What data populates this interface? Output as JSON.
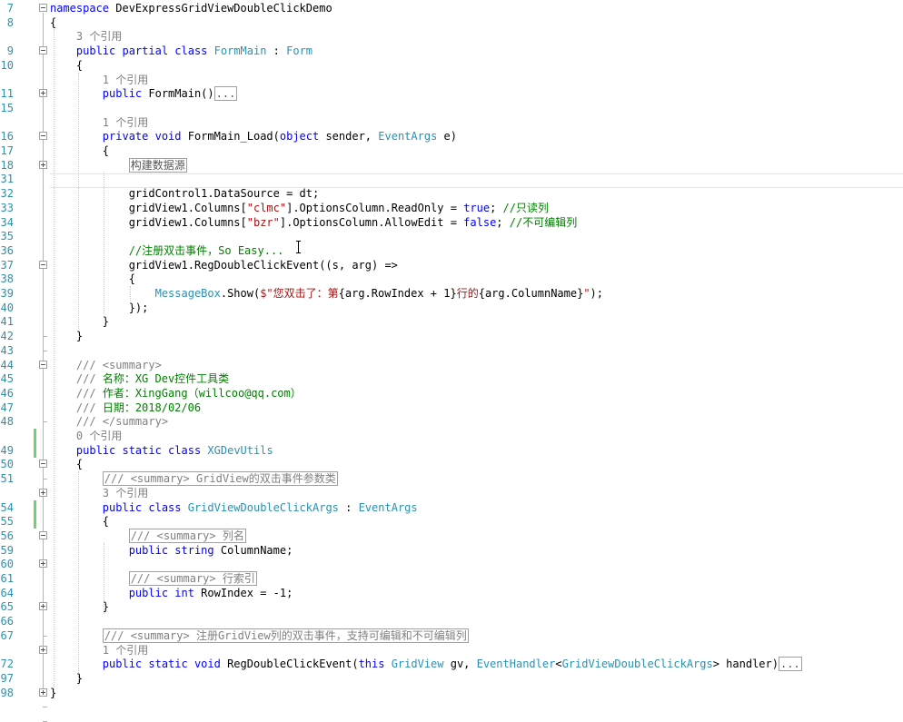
{
  "editor": {
    "lines": [
      {
        "num": "7",
        "tokens": [
          {
            "t": "kw",
            "v": "namespace"
          },
          {
            "t": "pl",
            "v": " DevExpressGridViewDoubleClickDemo"
          }
        ]
      },
      {
        "num": "8",
        "tokens": [
          {
            "t": "pl",
            "v": "{"
          }
        ]
      },
      {
        "num": "",
        "tokens": [
          {
            "t": "ref",
            "v": "    3 个引用"
          }
        ]
      },
      {
        "num": "9",
        "tokens": [
          {
            "t": "pl",
            "v": "    "
          },
          {
            "t": "kw",
            "v": "public partial class"
          },
          {
            "t": "pl",
            "v": " "
          },
          {
            "t": "ty",
            "v": "FormMain"
          },
          {
            "t": "pl",
            "v": " : "
          },
          {
            "t": "ty",
            "v": "Form"
          }
        ]
      },
      {
        "num": "10",
        "tokens": [
          {
            "t": "pl",
            "v": "    {"
          }
        ]
      },
      {
        "num": "",
        "tokens": [
          {
            "t": "ref",
            "v": "        1 个引用"
          }
        ]
      },
      {
        "num": "11",
        "tokens": [
          {
            "t": "pl",
            "v": "        "
          },
          {
            "t": "kw",
            "v": "public"
          },
          {
            "t": "pl",
            "v": " FormMain()"
          },
          {
            "t": "box",
            "v": "..."
          }
        ]
      },
      {
        "num": "15",
        "tokens": []
      },
      {
        "num": "",
        "tokens": [
          {
            "t": "ref",
            "v": "        1 个引用"
          }
        ]
      },
      {
        "num": "16",
        "tokens": [
          {
            "t": "pl",
            "v": "        "
          },
          {
            "t": "kw",
            "v": "private void"
          },
          {
            "t": "pl",
            "v": " FormMain_Load("
          },
          {
            "t": "kw",
            "v": "object"
          },
          {
            "t": "pl",
            "v": " sender, "
          },
          {
            "t": "ty",
            "v": "EventArgs"
          },
          {
            "t": "pl",
            "v": " e)"
          }
        ]
      },
      {
        "num": "17",
        "tokens": [
          {
            "t": "pl",
            "v": "        {"
          }
        ]
      },
      {
        "num": "18",
        "tokens": [
          {
            "t": "pl",
            "v": "            "
          },
          {
            "t": "box",
            "v": "构建数据源"
          }
        ]
      },
      {
        "num": "31",
        "tokens": []
      },
      {
        "num": "32",
        "tokens": [
          {
            "t": "pl",
            "v": "            gridControl1.DataSource = dt;"
          }
        ]
      },
      {
        "num": "33",
        "tokens": [
          {
            "t": "pl",
            "v": "            gridView1.Columns["
          },
          {
            "t": "st",
            "v": "\"clmc\""
          },
          {
            "t": "pl",
            "v": "].OptionsColumn.ReadOnly = "
          },
          {
            "t": "kw",
            "v": "true"
          },
          {
            "t": "pl",
            "v": "; "
          },
          {
            "t": "cm",
            "v": "//只读列"
          }
        ]
      },
      {
        "num": "34",
        "tokens": [
          {
            "t": "pl",
            "v": "            gridView1.Columns["
          },
          {
            "t": "st",
            "v": "\"bzr\""
          },
          {
            "t": "pl",
            "v": "].OptionsColumn.AllowEdit = "
          },
          {
            "t": "kw",
            "v": "false"
          },
          {
            "t": "pl",
            "v": "; "
          },
          {
            "t": "cm",
            "v": "//不可编辑列"
          }
        ]
      },
      {
        "num": "35",
        "tokens": []
      },
      {
        "num": "36",
        "tokens": [
          {
            "t": "pl",
            "v": "            "
          },
          {
            "t": "cm",
            "v": "//注册双击事件，So Easy..."
          }
        ]
      },
      {
        "num": "37",
        "tokens": [
          {
            "t": "pl",
            "v": "            gridView1.RegDoubleClickEvent((s, arg) =>"
          }
        ]
      },
      {
        "num": "38",
        "tokens": [
          {
            "t": "pl",
            "v": "            {"
          }
        ]
      },
      {
        "num": "39",
        "tokens": [
          {
            "t": "pl",
            "v": "                "
          },
          {
            "t": "ty",
            "v": "MessageBox"
          },
          {
            "t": "pl",
            "v": ".Show("
          },
          {
            "t": "st",
            "v": "$\"您双击了：第"
          },
          {
            "t": "pl",
            "v": "{arg.RowIndex + 1}"
          },
          {
            "t": "st",
            "v": "行的"
          },
          {
            "t": "pl",
            "v": "{arg.ColumnName}"
          },
          {
            "t": "st",
            "v": "\""
          },
          {
            "t": "pl",
            "v": ");"
          }
        ]
      },
      {
        "num": "40",
        "tokens": [
          {
            "t": "pl",
            "v": "            });"
          }
        ]
      },
      {
        "num": "41",
        "tokens": [
          {
            "t": "pl",
            "v": "        }"
          }
        ]
      },
      {
        "num": "42",
        "tokens": [
          {
            "t": "pl",
            "v": "    }"
          }
        ]
      },
      {
        "num": "43",
        "tokens": []
      },
      {
        "num": "44",
        "tokens": [
          {
            "t": "pl",
            "v": "    "
          },
          {
            "t": "dc",
            "v": "/// <summary>"
          }
        ]
      },
      {
        "num": "45",
        "tokens": [
          {
            "t": "pl",
            "v": "    "
          },
          {
            "t": "dc",
            "v": "///"
          },
          {
            "t": "cm",
            "v": " 名称：XG Dev控件工具类"
          }
        ]
      },
      {
        "num": "46",
        "tokens": [
          {
            "t": "pl",
            "v": "    "
          },
          {
            "t": "dc",
            "v": "///"
          },
          {
            "t": "cm",
            "v": " 作者：XingGang（willcoo@qq.com）"
          }
        ]
      },
      {
        "num": "47",
        "tokens": [
          {
            "t": "pl",
            "v": "    "
          },
          {
            "t": "dc",
            "v": "///"
          },
          {
            "t": "cm",
            "v": " 日期：2018/02/06"
          }
        ]
      },
      {
        "num": "48",
        "tokens": [
          {
            "t": "pl",
            "v": "    "
          },
          {
            "t": "dc",
            "v": "/// </summary>"
          }
        ]
      },
      {
        "num": "",
        "tokens": [
          {
            "t": "ref",
            "v": "    0 个引用"
          }
        ]
      },
      {
        "num": "49",
        "tokens": [
          {
            "t": "pl",
            "v": "    "
          },
          {
            "t": "kw",
            "v": "public static class"
          },
          {
            "t": "pl",
            "v": " "
          },
          {
            "t": "ty",
            "v": "XGDevUtils"
          }
        ]
      },
      {
        "num": "50",
        "tokens": [
          {
            "t": "pl",
            "v": "    {"
          }
        ]
      },
      {
        "num": "51",
        "tokens": [
          {
            "t": "pl",
            "v": "        "
          },
          {
            "t": "boxc",
            "v": "/// <summary> GridView的双击事件参数类"
          }
        ]
      },
      {
        "num": "",
        "tokens": [
          {
            "t": "ref",
            "v": "        3 个引用"
          }
        ]
      },
      {
        "num": "54",
        "tokens": [
          {
            "t": "pl",
            "v": "        "
          },
          {
            "t": "kw",
            "v": "public class"
          },
          {
            "t": "pl",
            "v": " "
          },
          {
            "t": "ty",
            "v": "GridViewDoubleClickArgs"
          },
          {
            "t": "pl",
            "v": " : "
          },
          {
            "t": "ty",
            "v": "EventArgs"
          }
        ]
      },
      {
        "num": "55",
        "tokens": [
          {
            "t": "pl",
            "v": "        {"
          }
        ]
      },
      {
        "num": "56",
        "tokens": [
          {
            "t": "pl",
            "v": "            "
          },
          {
            "t": "boxc",
            "v": "/// <summary> 列名"
          }
        ]
      },
      {
        "num": "59",
        "tokens": [
          {
            "t": "pl",
            "v": "            "
          },
          {
            "t": "kw",
            "v": "public string"
          },
          {
            "t": "pl",
            "v": " ColumnName;"
          }
        ]
      },
      {
        "num": "60",
        "tokens": []
      },
      {
        "num": "61",
        "tokens": [
          {
            "t": "pl",
            "v": "            "
          },
          {
            "t": "boxc",
            "v": "/// <summary> 行索引"
          }
        ]
      },
      {
        "num": "64",
        "tokens": [
          {
            "t": "pl",
            "v": "            "
          },
          {
            "t": "kw",
            "v": "public int"
          },
          {
            "t": "pl",
            "v": " RowIndex = -1;"
          }
        ]
      },
      {
        "num": "65",
        "tokens": [
          {
            "t": "pl",
            "v": "        }"
          }
        ]
      },
      {
        "num": "66",
        "tokens": []
      },
      {
        "num": "67",
        "tokens": [
          {
            "t": "pl",
            "v": "        "
          },
          {
            "t": "boxc",
            "v": "/// <summary> 注册GridView列的双击事件，支持可编辑和不可编辑列"
          }
        ]
      },
      {
        "num": "",
        "tokens": [
          {
            "t": "ref",
            "v": "        1 个引用"
          }
        ]
      },
      {
        "num": "72",
        "tokens": [
          {
            "t": "pl",
            "v": "        "
          },
          {
            "t": "kw",
            "v": "public static void"
          },
          {
            "t": "pl",
            "v": " RegDoubleClickEvent("
          },
          {
            "t": "kw",
            "v": "this"
          },
          {
            "t": "pl",
            "v": " "
          },
          {
            "t": "ty",
            "v": "GridView"
          },
          {
            "t": "pl",
            "v": " gv, "
          },
          {
            "t": "ty",
            "v": "EventHandler"
          },
          {
            "t": "pl",
            "v": "<"
          },
          {
            "t": "ty",
            "v": "GridViewDoubleClickArgs"
          },
          {
            "t": "pl",
            "v": "> handler)"
          },
          {
            "t": "box",
            "v": "..."
          }
        ]
      },
      {
        "num": "97",
        "tokens": [
          {
            "t": "pl",
            "v": "    }"
          }
        ]
      },
      {
        "num": "98",
        "tokens": [
          {
            "t": "pl",
            "v": "}"
          }
        ]
      }
    ]
  }
}
